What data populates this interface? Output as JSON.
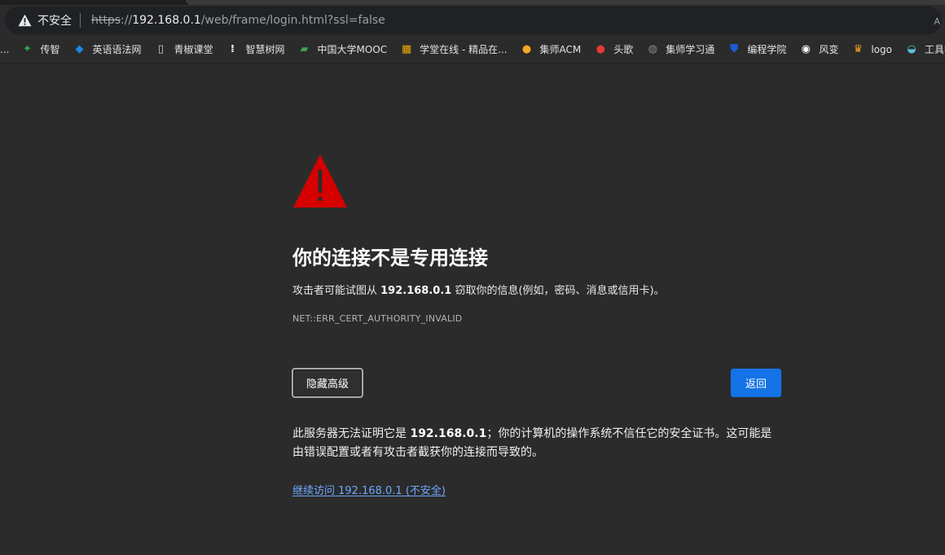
{
  "address_bar": {
    "security_label": "不安全",
    "url_scheme": "https",
    "url_sep": "://",
    "url_host": "192.168.0.1",
    "url_path": "/web/frame/login.html?ssl=false",
    "end_char": "A"
  },
  "bookmarks": {
    "overflow": "...",
    "items": [
      {
        "label": "传智",
        "icon": "chuanzhi-icon",
        "color": "#2fa84f"
      },
      {
        "label": "英语语法网",
        "icon": "grammar-icon",
        "color": "#1e88e5"
      },
      {
        "label": "青椒课堂",
        "icon": "document-icon",
        "color": "#cfcfcf"
      },
      {
        "label": "智慧树网",
        "icon": "zhihuishu-icon",
        "color": "#ffffff"
      },
      {
        "label": "中国大学MOOC",
        "icon": "mooc-icon",
        "color": "#3aa05a"
      },
      {
        "label": "学堂在线 - 精品在...",
        "icon": "xuetang-icon",
        "color": "#f2a900"
      },
      {
        "label": "集师ACM",
        "icon": "acm-icon",
        "color": "#f5a623"
      },
      {
        "label": "头歌",
        "icon": "touge-icon",
        "color": "#e53935"
      },
      {
        "label": "集师学习通",
        "icon": "globe-icon",
        "color": "#8a8a8a"
      },
      {
        "label": "编程学院",
        "icon": "shield-icon",
        "color": "#1e5bd6"
      },
      {
        "label": "风变",
        "icon": "panda-icon",
        "color": "#ffffff"
      },
      {
        "label": "logo",
        "icon": "logo-icon",
        "color": "#f0a020"
      },
      {
        "label": "工具猫",
        "icon": "cat-icon",
        "color": "#5bc0de"
      }
    ]
  },
  "page": {
    "title": "你的连接不是专用连接",
    "desc_prefix": "攻击者可能试图从 ",
    "desc_host": "192.168.0.1",
    "desc_suffix": " 窃取你的信息(例如，密码、消息或信用卡)。",
    "error_code": "NET::ERR_CERT_AUTHORITY_INVALID",
    "advanced_button": "隐藏高级",
    "back_button": "返回",
    "detail_prefix": "此服务器无法证明它是 ",
    "detail_host": "192.168.0.1",
    "detail_suffix": "；你的计算机的操作系统不信任它的安全证书。这可能是由错误配置或者有攻击者截获你的连接而导致的。",
    "proceed_link": "继续访问 192.168.0.1 (不安全)"
  },
  "colors": {
    "background": "#2b2b2b",
    "warning_red": "#d50000",
    "primary_button": "#1473e6",
    "link": "#6ea8ff"
  }
}
